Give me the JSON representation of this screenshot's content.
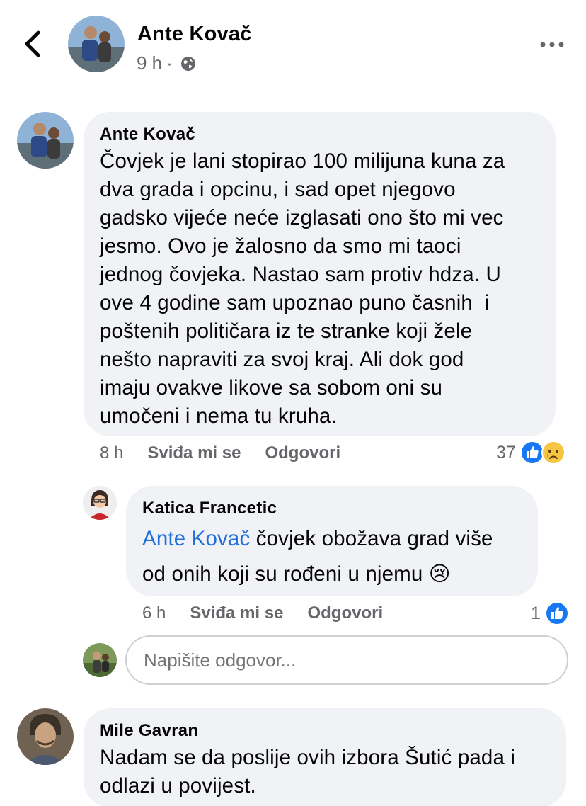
{
  "header": {
    "name": "Ante Kovač",
    "time": "9 h",
    "separator": "·"
  },
  "comments": [
    {
      "author": "Ante Kovač",
      "lines": [
        "Čovjek je lani stopirao 100 milijuna kuna za",
        "dva grada i opcinu, i sad opet njegovo",
        "gadsko vijeće neće izglasati ono što mi vec",
        "jesmo. Ovo je žalosno da smo mi taoci",
        "jednog čovjeka. Nastao sam protiv hdza. U",
        "ove 4 godine sam upoznao puno časnih  i",
        "poštenih političara iz te stranke koji žele",
        "nešto napraviti za svoj kraj. Ali dok god",
        "imaju ovakve likove sa sobom oni su",
        "umočeni i nema tu kruha."
      ],
      "time": "8 h",
      "like_label": "Sviđa mi se",
      "reply_label": "Odgovori",
      "reaction_count": "37",
      "reactions": [
        "like-icon",
        "sad-icon"
      ]
    },
    {
      "author": "Katica Francetic",
      "mention": "Ante Kovač",
      "line1_rest": " čovjek obožava grad više",
      "line2": "od onih koji su rođeni u njemu ",
      "emoji": "😢",
      "time": "6 h",
      "like_label": "Sviđa mi se",
      "reply_label": "Odgovori",
      "reaction_count": "1",
      "reactions": [
        "like-icon"
      ]
    },
    {
      "author": "Mile Gavran",
      "lines": [
        "Nadam se da poslije ovih izbora Šutić pada i",
        "odlazi u povijest."
      ]
    }
  ],
  "reply_box": {
    "placeholder": "Napišite odgovor..."
  },
  "colors": {
    "like_blue": "#1877f2",
    "mention_blue": "#216fdb",
    "bubble_bg": "#f0f2f5",
    "secondary_text": "#65676b"
  }
}
